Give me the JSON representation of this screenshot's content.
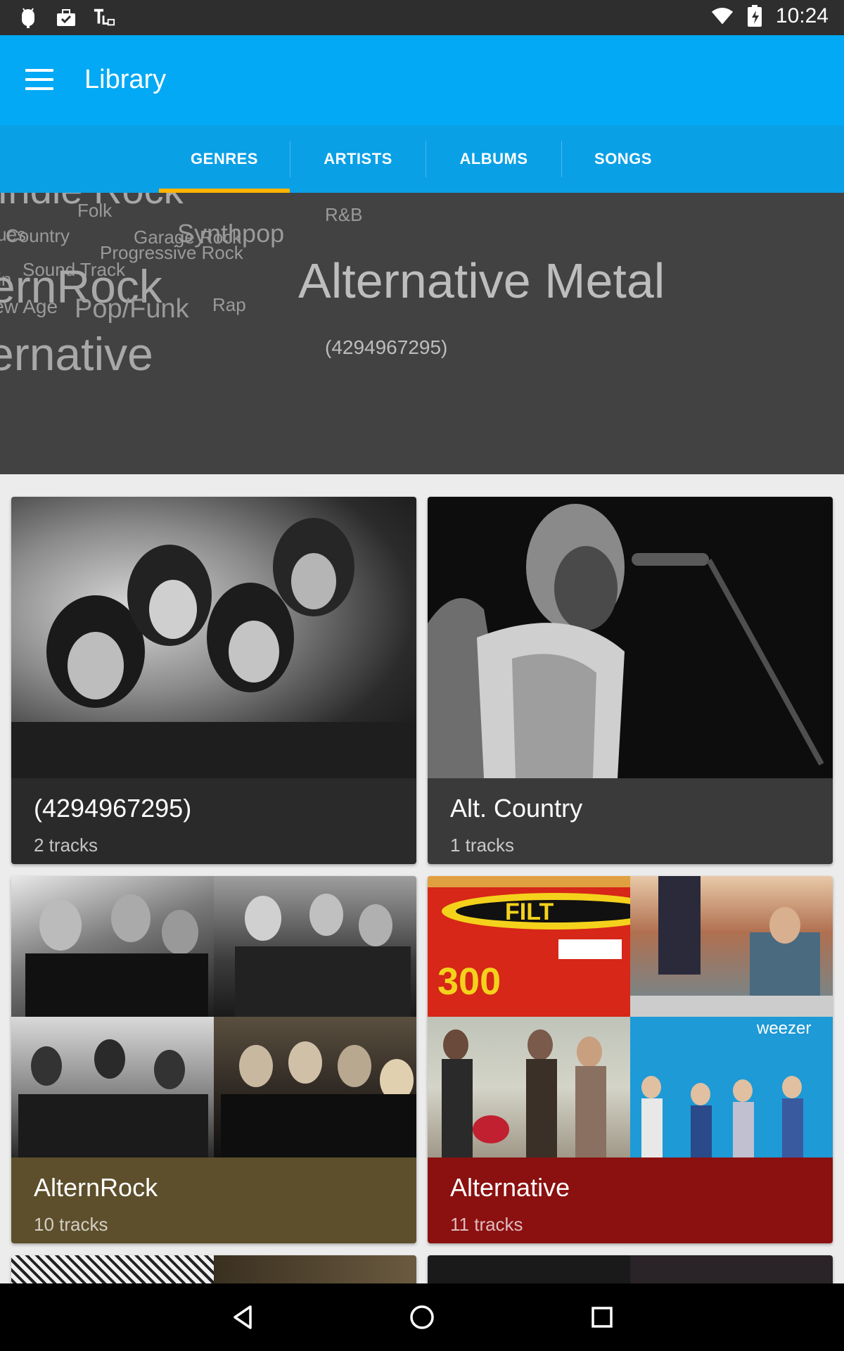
{
  "status_bar": {
    "time": "10:24",
    "icons": [
      "android-debug-icon",
      "briefcase-icon",
      "text-lock-icon",
      "wifi-icon",
      "battery-icon"
    ]
  },
  "app_bar": {
    "title": "Library",
    "menu_icon": "hamburger-menu-icon"
  },
  "tabs": [
    {
      "label": "GENRES",
      "active": true
    },
    {
      "label": "ARTISTS",
      "active": false
    },
    {
      "label": "ALBUMS",
      "active": false
    },
    {
      "label": "SONGS",
      "active": false
    }
  ],
  "genre_cloud": {
    "selected": "Alternative Metal",
    "selected_count": "(4294967295)",
    "words": [
      "Indie Rock",
      "Folk",
      "R&B",
      "Blues",
      "Country",
      "Garage Rock",
      "Synthpop",
      "Progressive Rock",
      "Sound Track",
      "Latin",
      "AlternRock",
      "New Age",
      "Pop/Funk",
      "Rap",
      "Alternative"
    ]
  },
  "genres": [
    {
      "name": "(4294967295)",
      "tracks": "2 tracks",
      "color": "#2a2a2a"
    },
    {
      "name": "Alt. Country",
      "tracks": "1 tracks",
      "color": "#3a3a3a"
    },
    {
      "name": "AlternRock",
      "tracks": "10 tracks",
      "color": "#5d4f2c"
    },
    {
      "name": "Alternative",
      "tracks": "11 tracks",
      "color": "#8b1010"
    }
  ],
  "album_art_text": {
    "filter_logo": "FILT",
    "filter_number": "300",
    "weezer_logo": "weezer"
  },
  "colors": {
    "app_bar": "#03a9f4",
    "tab_indicator": "#ffb300",
    "cloud_bg": "#424242"
  },
  "nav_bar": {
    "back_icon": "back-triangle-icon",
    "home_icon": "home-circle-icon",
    "recents_icon": "recents-square-icon"
  }
}
